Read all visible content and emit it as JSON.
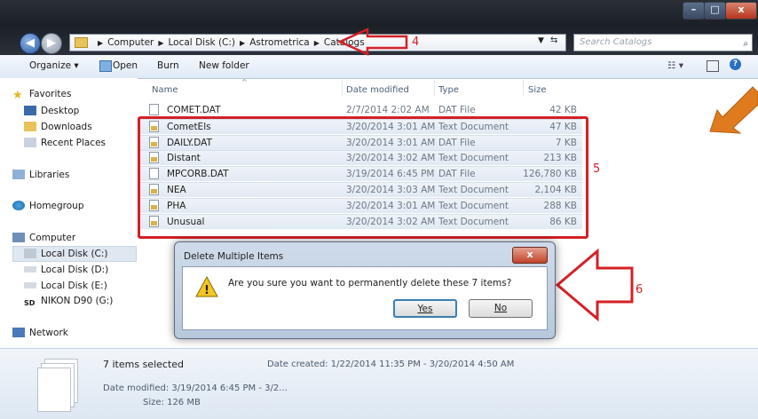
{
  "window": {
    "address": {
      "parts": [
        "Computer",
        "Local Disk (C:)",
        "Astrometrica",
        "Catalogs"
      ]
    },
    "search_placeholder": "Search Catalogs",
    "controls": {
      "minimize": "–",
      "maximize": "□",
      "close": "x"
    }
  },
  "toolbar": {
    "organize": "Organize ▾",
    "open": "Open",
    "burn": "Burn",
    "new_folder": "New folder"
  },
  "nav": {
    "favorites": "Favorites",
    "desktop": "Desktop",
    "downloads": "Downloads",
    "recent_places": "Recent Places",
    "libraries": "Libraries",
    "homegroup": "Homegroup",
    "computer": "Computer",
    "local_c": "Local Disk (C:)",
    "local_d": "Local Disk (D:)",
    "local_e": "Local Disk (E:)",
    "nikon": "NIKON D90 (G:)",
    "network": "Network"
  },
  "columns": {
    "name": "Name",
    "date": "Date modified",
    "type": "Type",
    "size": "Size"
  },
  "files": [
    {
      "name": "COMET.DAT",
      "date": "2/7/2014 2:02 AM",
      "type": "DAT File",
      "size": "42 KB",
      "icon": "file-icon"
    },
    {
      "name": "CometEls",
      "date": "3/20/2014 3:01 AM",
      "type": "Text Document",
      "size": "47 KB",
      "icon": "text-file-icon"
    },
    {
      "name": "DAILY.DAT",
      "date": "3/20/2014 3:01 AM",
      "type": "DAT File",
      "size": "7 KB",
      "icon": "text-file-icon"
    },
    {
      "name": "Distant",
      "date": "3/20/2014 3:02 AM",
      "type": "Text Document",
      "size": "213 KB",
      "icon": "text-file-icon"
    },
    {
      "name": "MPCORB.DAT",
      "date": "3/19/2014 6:45 PM",
      "type": "DAT File",
      "size": "126,780 KB",
      "icon": "file-icon"
    },
    {
      "name": "NEA",
      "date": "3/20/2014 3:03 AM",
      "type": "Text Document",
      "size": "2,104 KB",
      "icon": "text-file-icon"
    },
    {
      "name": "PHA",
      "date": "3/20/2014 3:01 AM",
      "type": "Text Document",
      "size": "288 KB",
      "icon": "text-file-icon"
    },
    {
      "name": "Unusual",
      "date": "3/20/2014 3:02 AM",
      "type": "Text Document",
      "size": "86 KB",
      "icon": "text-file-icon"
    }
  ],
  "annotations": {
    "n4": "4",
    "n5": "5",
    "n6": "6",
    "color": "#d42026",
    "arrow_orange": "#e07a1f"
  },
  "dialog": {
    "title": "Delete Multiple Items",
    "message": "Are you sure you want to permanently delete these 7 items?",
    "yes": "Yes",
    "no": "No",
    "close": "x"
  },
  "details": {
    "selected": "7 items selected",
    "date_created": "Date created: 1/22/2014 11:35 PM - 3/20/2014 4:50 AM",
    "date_modified": "Date modified: 3/19/2014 6:45 PM - 3/2...",
    "size": "Size: 126 MB"
  }
}
